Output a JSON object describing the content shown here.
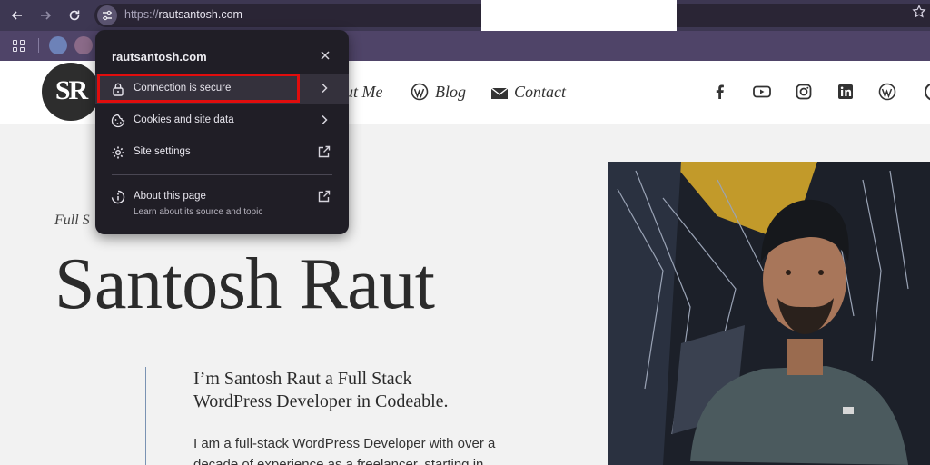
{
  "browser": {
    "url_scheme": "https://",
    "url_host": "rautsantosh.com",
    "back_icon": "arrow-left-icon",
    "forward_icon": "arrow-right-icon",
    "reload_icon": "reload-icon",
    "site_info_icon": "tune-icon",
    "bookmark_icon": "star-icon",
    "apps_icon": "apps-grid-icon"
  },
  "site_info_popup": {
    "title": "rautsantosh.com",
    "close_icon": "close-icon",
    "items": [
      {
        "label": "Connection is secure",
        "icon": "lock-icon",
        "trailing": "chevron-right-icon"
      },
      {
        "label": "Cookies and site data",
        "icon": "cookie-icon",
        "trailing": "chevron-right-icon"
      },
      {
        "label": "Site settings",
        "icon": "gear-icon",
        "trailing": "external-link-icon"
      },
      {
        "label": "About this page",
        "sublabel": "Learn about its source and topic",
        "icon": "info-icon",
        "trailing": "external-link-icon"
      }
    ],
    "highlight_color": "#e00d0d"
  },
  "website": {
    "logo_text": "SR",
    "nav": [
      {
        "label": "ut Me"
      },
      {
        "label": "Blog",
        "icon": "wordpress-icon"
      },
      {
        "label": "Contact",
        "icon": "mail-icon"
      }
    ],
    "social_icons": [
      "facebook-icon",
      "youtube-icon",
      "instagram-icon",
      "linkedin-icon",
      "wordpress-icon"
    ],
    "hero_subtitle": "Full S",
    "hero_title": "Santosh Raut",
    "intro": "I’m Santosh Raut a Full Stack WordPress Developer in Codeable.",
    "body": "I am a full-stack WordPress Developer with over a decade of experience as a freelancer, starting in"
  },
  "colors": {
    "toolbar": "#3d3752",
    "bookmarks_bar": "#4f4468",
    "popup_bg": "#201e26",
    "page_bg": "#f2f2f2"
  }
}
